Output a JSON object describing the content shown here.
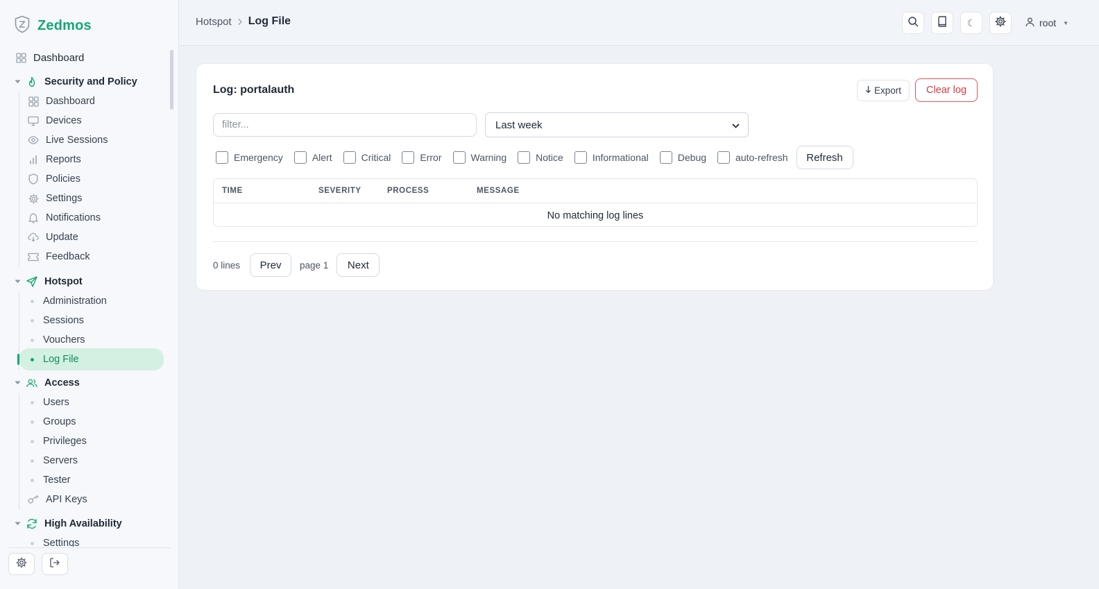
{
  "brand": {
    "name": "Zedmos",
    "logo_icon": "shield-z-icon",
    "accent": "#14a872"
  },
  "sidebar": {
    "top": {
      "label": "Dashboard",
      "icon": "grid-icon"
    },
    "sections": [
      {
        "label": "Security and Policy",
        "icon": "flame-icon",
        "items": [
          {
            "label": "Dashboard",
            "icon": "grid-icon"
          },
          {
            "label": "Devices",
            "icon": "monitor-icon"
          },
          {
            "label": "Live Sessions",
            "icon": "eye-icon"
          },
          {
            "label": "Reports",
            "icon": "bar-chart-icon"
          },
          {
            "label": "Policies",
            "icon": "shield-icon"
          },
          {
            "label": "Settings",
            "icon": "gear-icon"
          },
          {
            "label": "Notifications",
            "icon": "bell-icon"
          },
          {
            "label": "Update",
            "icon": "cloud-download-icon"
          },
          {
            "label": "Feedback",
            "icon": "ticket-icon"
          }
        ]
      },
      {
        "label": "Hotspot",
        "icon": "send-icon",
        "items": [
          {
            "label": "Administration"
          },
          {
            "label": "Sessions"
          },
          {
            "label": "Vouchers"
          },
          {
            "label": "Log File",
            "active": true
          }
        ]
      },
      {
        "label": "Access",
        "icon": "users-icon",
        "items": [
          {
            "label": "Users"
          },
          {
            "label": "Groups"
          },
          {
            "label": "Privileges"
          },
          {
            "label": "Servers"
          },
          {
            "label": "Tester"
          },
          {
            "label": "API Keys",
            "icon": "key-icon"
          }
        ]
      },
      {
        "label": "High Availability",
        "icon": "refresh-icon",
        "items": [
          {
            "label": "Settings"
          }
        ]
      }
    ],
    "footer": {
      "settings_icon": "gear-icon",
      "logout_icon": "logout-icon"
    }
  },
  "topbar": {
    "breadcrumb": [
      "Hotspot",
      "Log File"
    ],
    "actions": [
      "search-icon",
      "book-icon",
      "moon-icon",
      "gear-icon"
    ],
    "user": "root"
  },
  "log": {
    "title": "Log: portalauth",
    "export_label": "Export",
    "clear_label": "Clear log",
    "filter_placeholder": "filter...",
    "filter_value": "",
    "range_selected": "Last week",
    "severity_checks": [
      "Emergency",
      "Alert",
      "Critical",
      "Error",
      "Warning",
      "Notice",
      "Informational",
      "Debug",
      "auto-refresh"
    ],
    "refresh_label": "Refresh",
    "columns": [
      "TIME",
      "SEVERITY",
      "PROCESS",
      "MESSAGE"
    ],
    "empty_text": "No matching log lines",
    "line_count": "0 lines",
    "prev_label": "Prev",
    "page_label": "page 1",
    "next_label": "Next"
  },
  "colors": {
    "danger": "#d83a46",
    "active_bg": "#d3f0e3"
  }
}
